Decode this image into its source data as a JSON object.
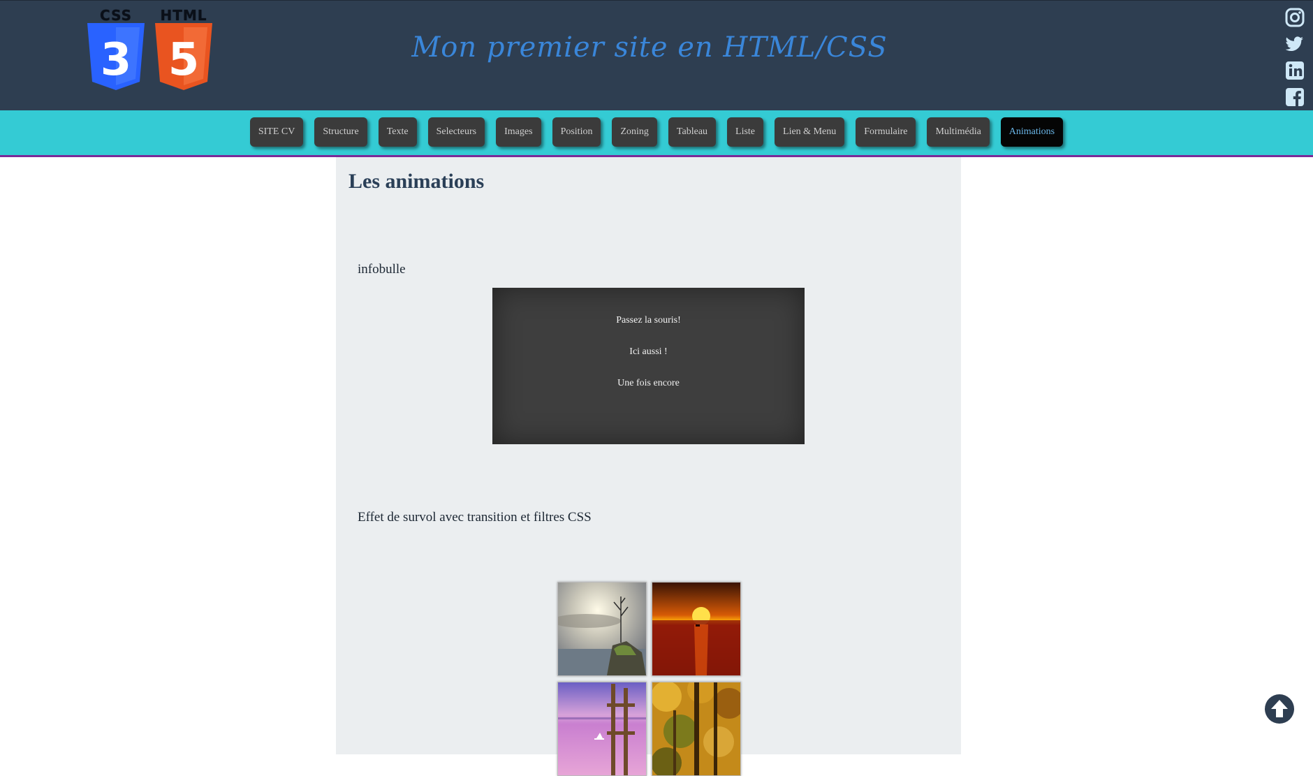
{
  "header": {
    "logos": [
      {
        "caption": "CSS",
        "numeral": "3",
        "color": "#2962ff",
        "icon": "css3-shield-icon"
      },
      {
        "caption": "HTML",
        "numeral": "5",
        "color": "#e95420",
        "icon": "html5-shield-icon"
      }
    ],
    "title": "Mon premier site en HTML/CSS",
    "social": [
      "instagram-icon",
      "twitter-icon",
      "linkedin-icon",
      "facebook-icon"
    ]
  },
  "nav": {
    "items": [
      "SITE CV",
      "Structure",
      "Texte",
      "Selecteurs",
      "Images",
      "Position",
      "Zoning",
      "Tableau",
      "Liste",
      "Lien & Menu",
      "Formulaire",
      "Multimédia",
      "Animations"
    ],
    "active": "Animations"
  },
  "main": {
    "heading": "Les animations",
    "tooltip_section": {
      "label": "infobulle",
      "lines": [
        "Passez la souris!",
        "Ici aussi !",
        "Une fois encore"
      ]
    },
    "hover_section": {
      "label": "Effet de survol avec transition et filtres CSS",
      "images": [
        "tree-on-rock-sky-image",
        "sunset-sea-image",
        "purple-lake-pier-image",
        "autumn-forest-image"
      ]
    }
  },
  "scroll_top_icon": "arrow-up-circle-icon",
  "colors": {
    "header_bg": "#2e3e51",
    "nav_bg": "#34cbd4",
    "nav_border": "#7a2a98",
    "title": "#3a86d9",
    "main_bg": "#ebeef0",
    "active_btn_text": "#6ab6e8"
  }
}
